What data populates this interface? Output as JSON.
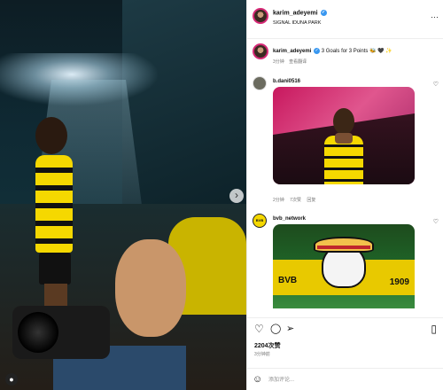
{
  "photo": {
    "next_arrow": "›"
  },
  "header": {
    "username": "karim_adeyemi",
    "verified_glyph": "✓",
    "location": "SIGNAL IDUNA PARK",
    "more": "···"
  },
  "caption": {
    "username": "karim_adeyemi",
    "verified_glyph": "✓",
    "text": "3 Goals for 3 Points 🐝 🖤 ✨",
    "time": "3分钟",
    "translate": "查看翻译"
  },
  "comments": [
    {
      "username": "b.dani0516",
      "time": "2分钟",
      "likes": "7次赞",
      "reply": "回复"
    },
    {
      "username": "bvb_network",
      "image_text_left": "BVB",
      "image_text_right": "1909"
    }
  ],
  "actions": {
    "like_icon": "♡",
    "comment_icon": "◯",
    "share_icon": "➢",
    "save_icon": "▯"
  },
  "likes": "2204次赞",
  "post_time": "3分钟前",
  "comment_box": {
    "emoji_icon": "☺",
    "placeholder": "添加评论..."
  },
  "colors": {
    "accent_yellow": "#f5d800",
    "verified_blue": "#3897f0",
    "muted_gray": "#737373"
  }
}
